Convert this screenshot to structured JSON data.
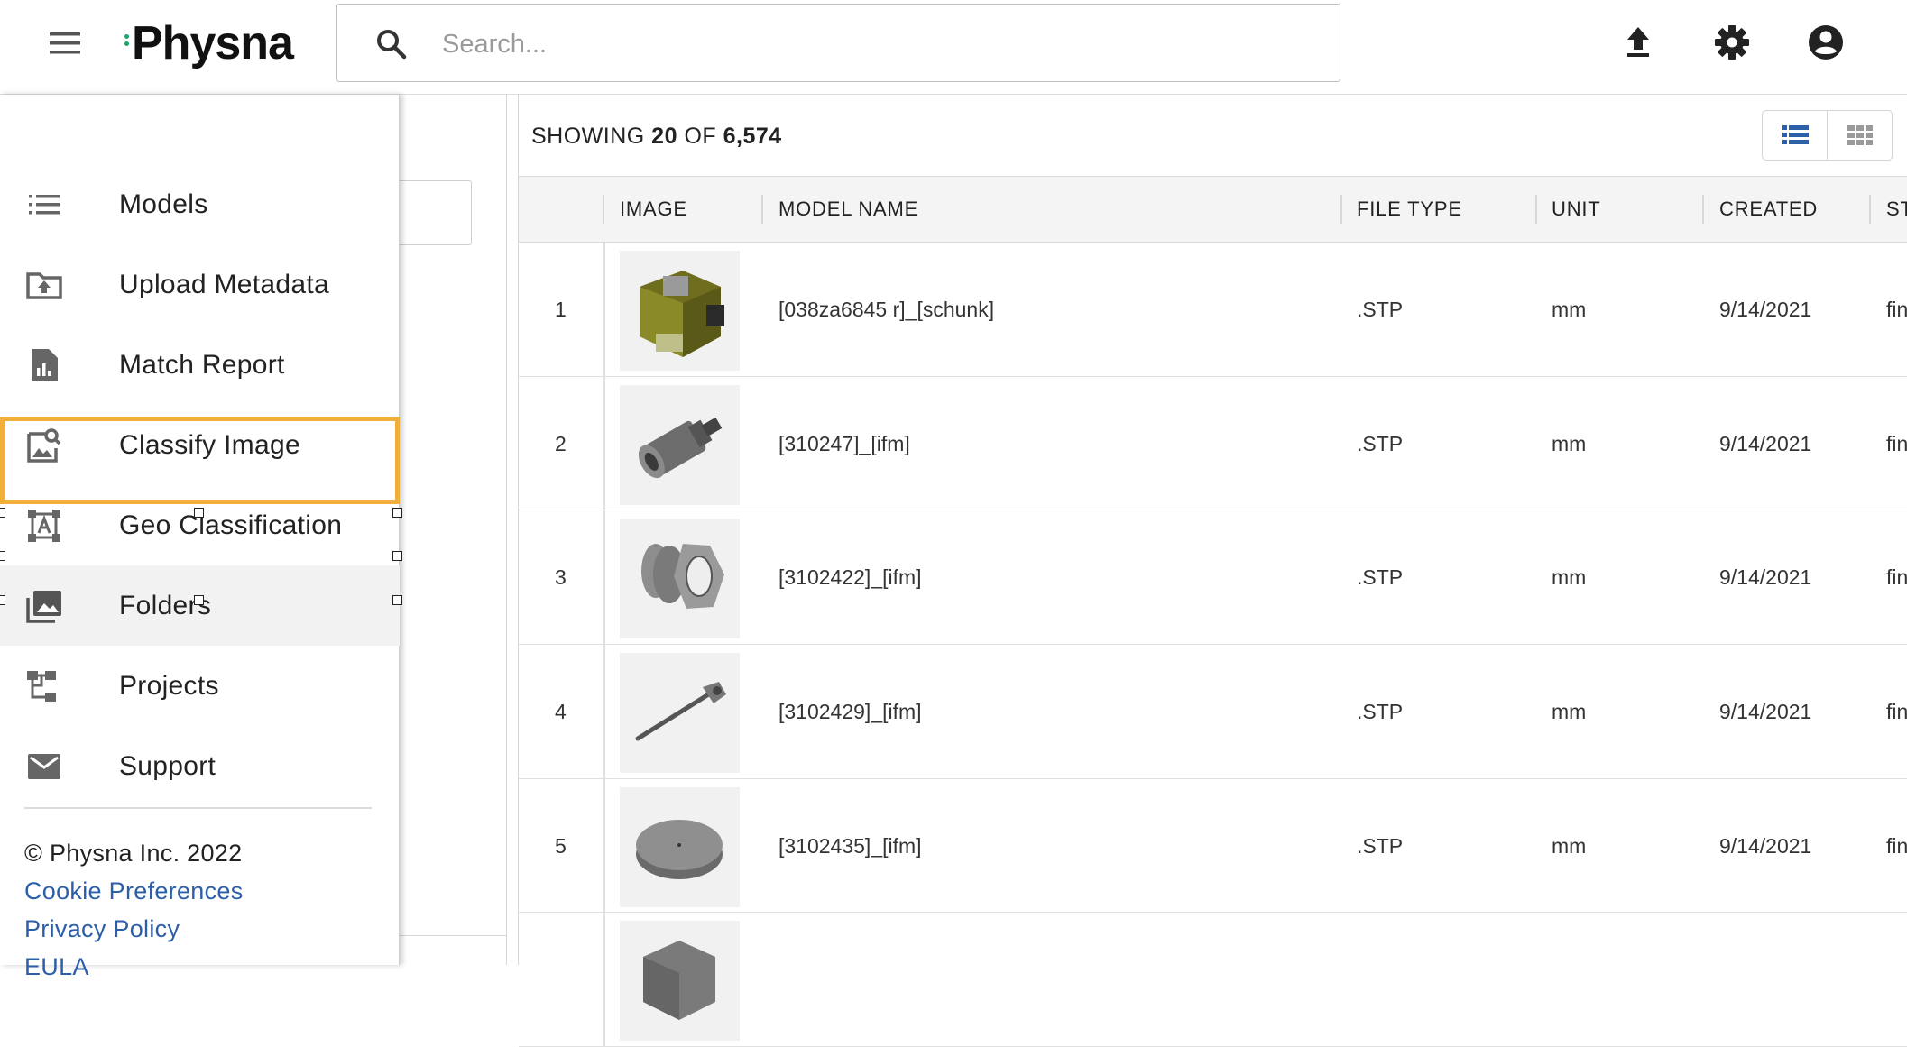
{
  "header": {
    "logo_text": "Physna",
    "search_placeholder": "Search..."
  },
  "results": {
    "showing_prefix": "SHOWING",
    "showing_count": "20",
    "showing_of": "OF",
    "showing_total": "6,574",
    "columns": [
      "IMAGE",
      "MODEL NAME",
      "FILE TYPE",
      "UNIT",
      "CREATED",
      "ST"
    ],
    "rows": [
      {
        "num": "1",
        "name": "[038za6845 r]_[schunk]",
        "file_type": ".STP",
        "unit": "mm",
        "created": "9/14/2021",
        "status": "fin"
      },
      {
        "num": "2",
        "name": "[310247]_[ifm]",
        "file_type": ".STP",
        "unit": "mm",
        "created": "9/14/2021",
        "status": "fin"
      },
      {
        "num": "3",
        "name": "[3102422]_[ifm]",
        "file_type": ".STP",
        "unit": "mm",
        "created": "9/14/2021",
        "status": "fin"
      },
      {
        "num": "4",
        "name": "[3102429]_[ifm]",
        "file_type": ".STP",
        "unit": "mm",
        "created": "9/14/2021",
        "status": "fin"
      },
      {
        "num": "5",
        "name": "[3102435]_[ifm]",
        "file_type": ".STP",
        "unit": "mm",
        "created": "9/14/2021",
        "status": "fin"
      }
    ]
  },
  "drawer": {
    "items": [
      {
        "label": "Models",
        "icon": "list-icon"
      },
      {
        "label": "Upload Metadata",
        "icon": "folder-upload-icon"
      },
      {
        "label": "Match Report",
        "icon": "report-icon"
      },
      {
        "label": "Classify Image",
        "icon": "image-search-icon"
      },
      {
        "label": "Geo Classification",
        "icon": "text-frame-icon"
      },
      {
        "label": "Folders",
        "icon": "photo-library-icon"
      },
      {
        "label": "Projects",
        "icon": "tree-icon"
      },
      {
        "label": "Support",
        "icon": "mail-icon"
      }
    ],
    "selected_index": 5,
    "copyright": "© Physna Inc. 2022",
    "links": [
      "Cookie Preferences",
      "Privacy Policy",
      "EULA"
    ]
  },
  "colors": {
    "accent_blue": "#2c5fa8",
    "selection_outline": "#f2ae3a",
    "logo_green": "#1aa56b"
  }
}
